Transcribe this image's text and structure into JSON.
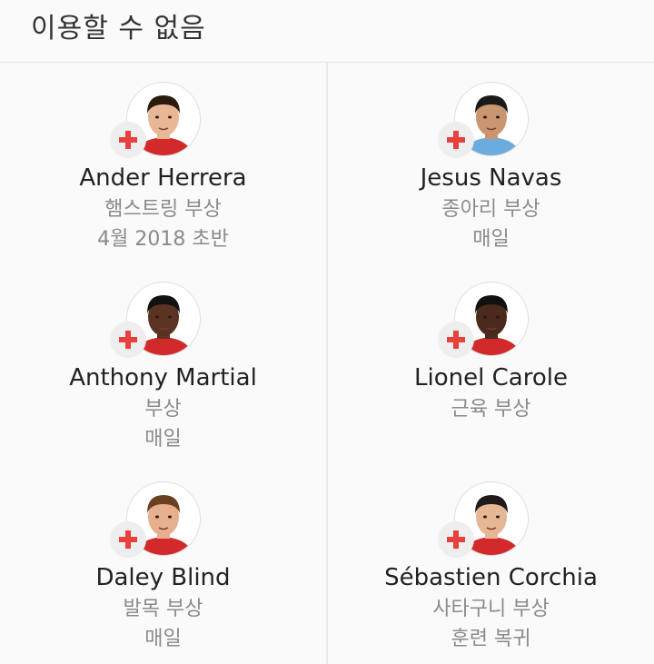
{
  "header": {
    "title": "이용할 수 없음"
  },
  "players": [
    {
      "name": "Ander Herrera",
      "injury": "햄스트링 부상",
      "return": "4월 2018 초반",
      "skin": "#e8b896",
      "hair": "#2a1a10",
      "shirt": "#d22a2a"
    },
    {
      "name": "Jesus Navas",
      "injury": "종아리 부상",
      "return": "매일",
      "skin": "#c99670",
      "hair": "#1a1a1a",
      "shirt": "#6cabdd"
    },
    {
      "name": "Anthony Martial",
      "injury": "부상",
      "return": "매일",
      "skin": "#5a3322",
      "hair": "#111111",
      "shirt": "#d22a2a"
    },
    {
      "name": "Lionel Carole",
      "injury": "근육 부상",
      "return": "",
      "skin": "#4a2a1c",
      "hair": "#111111",
      "shirt": "#d22a2a"
    },
    {
      "name": "Daley Blind",
      "injury": "발목 부상",
      "return": "매일",
      "skin": "#e6b08e",
      "hair": "#6b4020",
      "shirt": "#d22a2a"
    },
    {
      "name": "Sébastien Corchia",
      "injury": "사타구니 부상",
      "return": "훈련 복귀",
      "skin": "#e5b794",
      "hair": "#1f1a18",
      "shirt": "#d22a2a"
    }
  ],
  "colors": {
    "injury_cross": "#e8413c",
    "badge_bg": "#eeeeee"
  },
  "icons": {
    "injury": "red-cross-icon"
  }
}
